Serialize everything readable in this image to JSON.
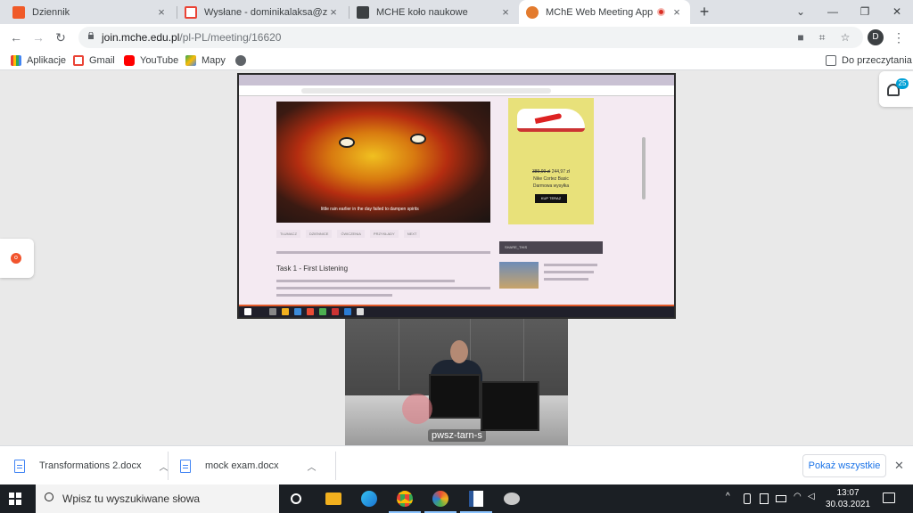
{
  "tabs": [
    {
      "title": "Dziennik",
      "icon": "dziennik-icon",
      "color": "#f05a28",
      "close": "×"
    },
    {
      "title": "Wysłane - dominikalaksa@zswol",
      "icon": "gmail-icon",
      "color": "#ea4335",
      "close": "×"
    },
    {
      "title": "MCHE koło naukowe",
      "icon": "document-icon",
      "color": "#3c4043",
      "close": "×"
    },
    {
      "title": "MChE Web Meeting App",
      "icon": "mche-logo-icon",
      "color": "#e37b2e",
      "close": "×",
      "active": true
    }
  ],
  "newtab": "+",
  "window_controls": {
    "menu": "⌄",
    "minimize": "—",
    "restore": "❐",
    "close": "✕"
  },
  "nav": {
    "back": "←",
    "forward": "→",
    "reload": "↻"
  },
  "address": {
    "host": "join.mche.edu.pl",
    "path": "/pl-PL/meeting/16620"
  },
  "profile": {
    "initial": "D"
  },
  "bookmarks": [
    {
      "label": "Aplikacje",
      "icon": "apps-grid-icon"
    },
    {
      "label": "Gmail",
      "icon": "gmail-icon"
    },
    {
      "label": "YouTube",
      "icon": "youtube-icon"
    },
    {
      "label": "Mapy",
      "icon": "maps-icon"
    },
    {
      "label": "",
      "icon": "globe-icon"
    }
  ],
  "reading_list": "Do przeczytania",
  "meeting": {
    "participants_count": "25",
    "camera_label": "pwsz-tarn-s",
    "record_label": "o",
    "shared_screen": {
      "video_caption": "little rain earlier in the day failed to dampen spirits",
      "tabs": [
        "TŁUMACZ",
        "DZIENNICE",
        "ĆWICZENIA",
        "PRZYKŁADY",
        "NEXT"
      ],
      "heading": "Task 1 - First Listening",
      "ad": {
        "old_price": "389,99 zł",
        "new_price": "244,97 zł",
        "product": "Nike Cortez Basic",
        "shipping": "Darmowa wysyłka",
        "button": "KUP TERAZ"
      },
      "sidebar_head": "SHARE_THIS"
    }
  },
  "downloads": {
    "items": [
      {
        "name": "Transformations 2.docx"
      },
      {
        "name": "mock exam.docx"
      }
    ],
    "show_all": "Pokaż wszystkie",
    "close": "✕"
  },
  "taskbar": {
    "search_placeholder": "Wpisz tu wyszukiwane słowa",
    "time": "13:07",
    "date": "30.03.2021"
  }
}
